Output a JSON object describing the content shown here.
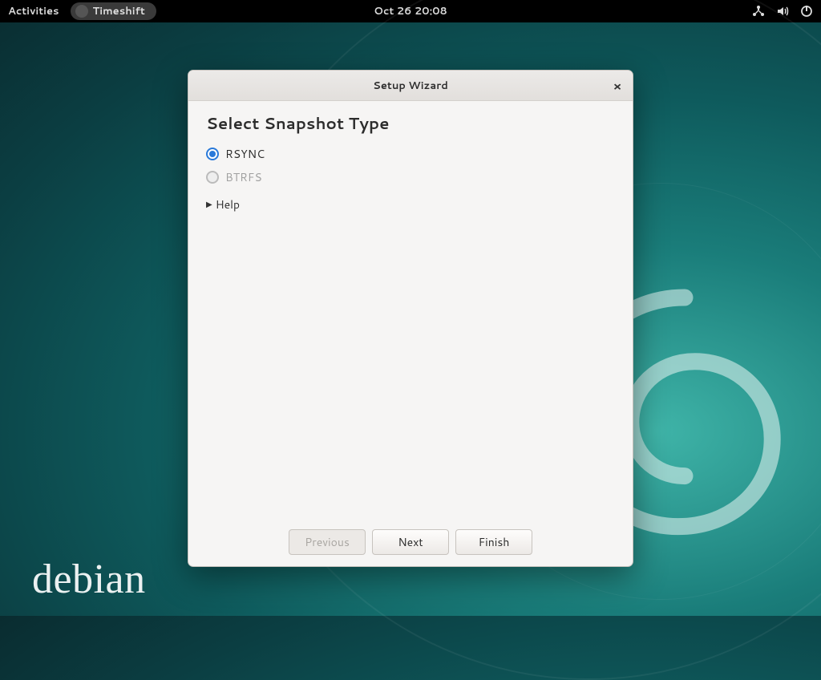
{
  "topbar": {
    "activities": "Activities",
    "app_name": "Timeshift",
    "clock": "Oct 26  20:08"
  },
  "desktop": {
    "distro_logo_text": "debian"
  },
  "dialog": {
    "title": "Setup Wizard",
    "close_glyph": "×",
    "heading": "Select Snapshot Type",
    "options": {
      "rsync": {
        "label": "RSYNC",
        "checked": true,
        "enabled": true
      },
      "btrfs": {
        "label": "BTRFS",
        "checked": false,
        "enabled": false
      }
    },
    "help_expander": "Help",
    "buttons": {
      "previous": "Previous",
      "next": "Next",
      "finish": "Finish"
    }
  }
}
